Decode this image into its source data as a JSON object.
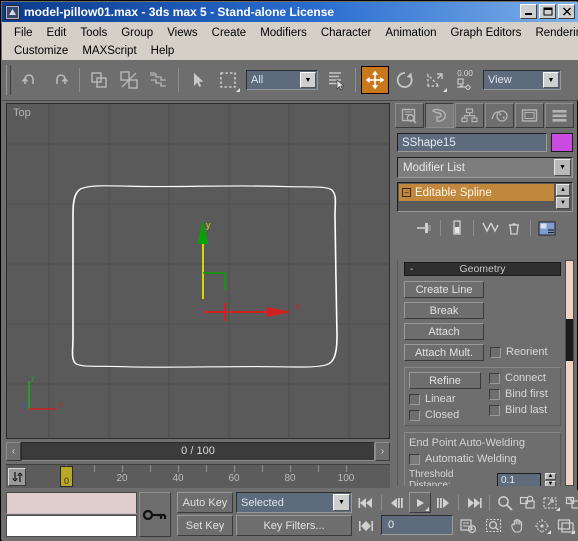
{
  "window": {
    "title": "model-pillow01.max - 3ds max 5 - Stand-alone License",
    "sysicon": "max-app-icon",
    "minimize": "_",
    "maximize": "□",
    "close": "✕"
  },
  "menubar": {
    "row1": [
      "File",
      "Edit",
      "Tools",
      "Group",
      "Views",
      "Create",
      "Modifiers",
      "Character",
      "Animation",
      "Graph Editors",
      "Rendering"
    ],
    "row2": [
      "Customize",
      "MAXScript",
      "Help"
    ]
  },
  "toolbar": {
    "undo": "undo-icon",
    "redo": "redo-icon",
    "select_link": "select-and-link-icon",
    "unlink": "unlink-selection-icon",
    "bind_spacewarp": "bind-to-space-warp-icon",
    "select_object": "select-object-icon",
    "select_region": "rectangular-selection-region-icon",
    "selection_filter": "All",
    "select_by_name": "select-by-name-icon",
    "select_move": "select-and-move-icon",
    "select_rotate": "select-and-rotate-icon",
    "select_scale": "select-and-uniform-scale-icon",
    "use_center": "use-pivot-point-center-icon",
    "spinner_value": "0.00",
    "ref_coord_system": "View"
  },
  "viewport": {
    "label": "Top",
    "axis_tripod": {
      "x": "x",
      "y": "y",
      "z": "z"
    },
    "gizmo": {
      "x_label": "x",
      "y_label": "y"
    },
    "object_color": "#ffffff",
    "grid_color": "#4e4e4e",
    "background": "#5a5a5a"
  },
  "timeslider": {
    "prev_label": "‹",
    "value": "0 / 100",
    "next_label": "›"
  },
  "trackbar": {
    "open_curve_editor": "↕",
    "current_frame": "0",
    "ticks": [
      0,
      10,
      20,
      30,
      40,
      50,
      60,
      70,
      80,
      90,
      100
    ],
    "tick_labels": [
      {
        "value": 20,
        "text": "20"
      },
      {
        "value": 40,
        "text": "40"
      },
      {
        "value": 60,
        "text": "60"
      },
      {
        "value": 80,
        "text": "80"
      },
      {
        "value": 100,
        "text": "100"
      }
    ]
  },
  "statusbar": {
    "prompt_text": "",
    "status_text": "",
    "lock_selection": "key-lock-selection-icon",
    "auto_key": "Auto Key",
    "set_key": "Set Key",
    "key_mode_selection": "Selected",
    "key_filters": "Key Filters...",
    "go_to_start": "go-to-start-icon",
    "previous_frame": "previous-frame-icon",
    "play": "play-animation-icon",
    "next_frame": "next-frame-icon",
    "go_to_end": "go-to-end-icon",
    "key_mode_toggle": "key-mode-toggle-icon",
    "frame_value": "0",
    "time_configuration": "time-configuration-icon",
    "zoom": "zoom-icon",
    "zoom_all": "zoom-all-icon",
    "zoom_extents": "zoom-extents-icon",
    "zoom_region": "zoom-region-icon",
    "region_zoom": "field-of-view-icon",
    "pan": "pan-view-icon",
    "arc_rotate": "arc-rotate-icon",
    "min_max_toggle": "min-max-viewport-toggle-icon"
  },
  "command_panel": {
    "tabs": [
      {
        "name": "create",
        "icon": "create-tab-icon",
        "selected": false
      },
      {
        "name": "modify",
        "icon": "modify-tab-icon",
        "selected": true
      },
      {
        "name": "hierarchy",
        "icon": "hierarchy-tab-icon",
        "selected": false
      },
      {
        "name": "motion",
        "icon": "motion-tab-icon",
        "selected": false
      },
      {
        "name": "display",
        "icon": "display-tab-icon",
        "selected": false
      },
      {
        "name": "utilities",
        "icon": "utilities-tab-icon",
        "selected": false
      }
    ],
    "object_name": "SShape15",
    "object_color_swatch": "#c84ce0",
    "modifier_list": "Modifier List",
    "stack": [
      {
        "label": "Editable Spline",
        "expanded": true,
        "selected": true
      }
    ],
    "stack_tools": [
      "pin-stack-icon",
      "show-end-result-icon",
      "make-unique-icon",
      "remove-modifier-icon",
      "configure-modifier-sets-icon"
    ],
    "rollouts": [
      {
        "title": "Geometry",
        "collapse_glyph": "-",
        "buttons": [
          "Create Line",
          "Break",
          "Attach",
          "Attach Mult."
        ],
        "checkboxes": [
          {
            "label": "Reorient",
            "checked": false
          }
        ],
        "refine": {
          "button": "Refine",
          "checkboxes": [
            {
              "label": "Connect",
              "checked": false
            },
            {
              "label": "Linear",
              "checked": false
            },
            {
              "label": "Bind first",
              "checked": false
            },
            {
              "label": "Closed",
              "checked": false
            },
            {
              "label": "Bind last",
              "checked": false
            }
          ]
        },
        "autoweld_group": {
          "title": "End Point Auto-Welding",
          "checkbox": {
            "label": "Automatic Welding",
            "checked": false
          },
          "threshold_label": "Threshold Distance:",
          "threshold_value": "0.1"
        }
      }
    ]
  }
}
